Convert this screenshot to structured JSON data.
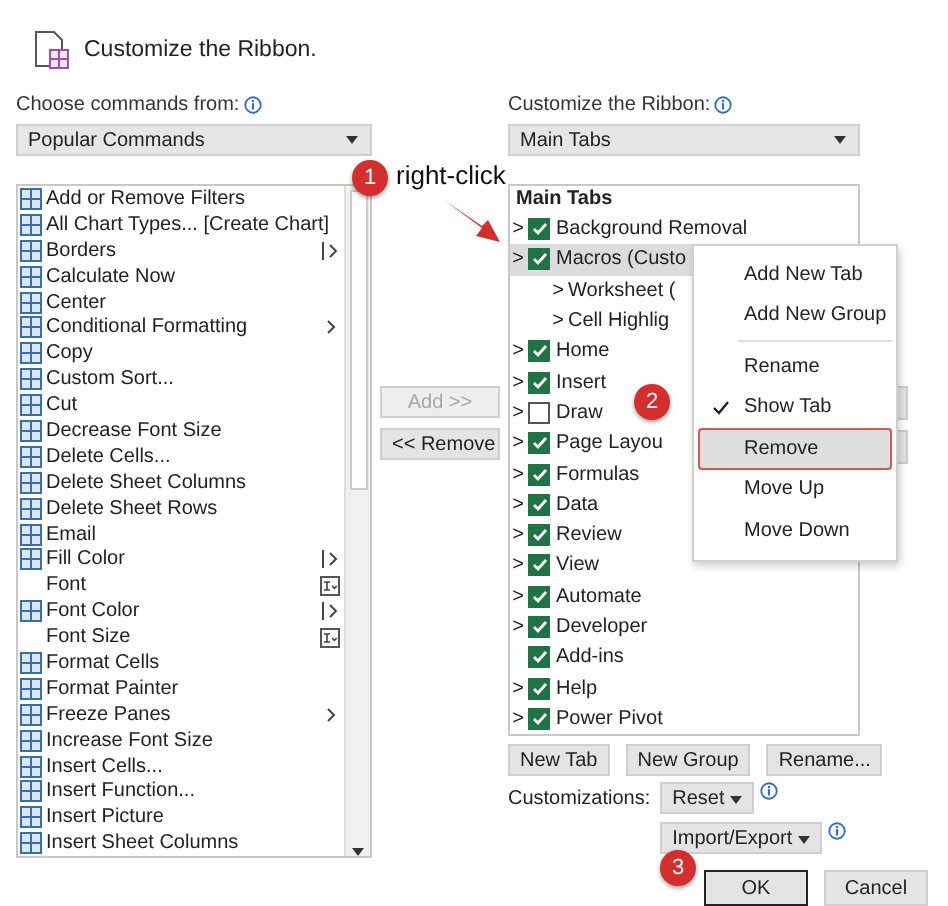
{
  "dialog": {
    "title": "Customize the Ribbon."
  },
  "commands": {
    "label": "Choose commands from:",
    "dropdown": "Popular Commands",
    "items": [
      {
        "label": "Add or Remove Filters",
        "kind": "command"
      },
      {
        "label": "All Chart Types... [Create Chart]",
        "kind": "command"
      },
      {
        "label": "Borders",
        "kind": "command",
        "split": true
      },
      {
        "label": "Calculate Now",
        "kind": "command"
      },
      {
        "label": "Center",
        "kind": "command"
      },
      {
        "label": "Conditional Formatting",
        "kind": "command",
        "submenu": true
      },
      {
        "label": "Copy",
        "kind": "command"
      },
      {
        "label": "Custom Sort...",
        "kind": "command"
      },
      {
        "label": "Cut",
        "kind": "command"
      },
      {
        "label": "Decrease Font Size",
        "kind": "command"
      },
      {
        "label": "Delete Cells...",
        "kind": "command"
      },
      {
        "label": "Delete Sheet Columns",
        "kind": "command"
      },
      {
        "label": "Delete Sheet Rows",
        "kind": "command"
      },
      {
        "label": "Email",
        "kind": "command"
      },
      {
        "label": "Fill Color",
        "kind": "command",
        "split": true
      },
      {
        "label": "Font",
        "kind": "plain",
        "combo": true
      },
      {
        "label": "Font Color",
        "kind": "command",
        "split": true
      },
      {
        "label": "Font Size",
        "kind": "plain",
        "combo": true
      },
      {
        "label": "Format Cells",
        "kind": "command"
      },
      {
        "label": "Format Painter",
        "kind": "command"
      },
      {
        "label": "Freeze Panes",
        "kind": "command",
        "submenu": true
      },
      {
        "label": "Increase Font Size",
        "kind": "command"
      },
      {
        "label": "Insert Cells...",
        "kind": "command"
      },
      {
        "label": "Insert Function...",
        "kind": "command"
      },
      {
        "label": "Insert Picture",
        "kind": "command"
      },
      {
        "label": "Insert Sheet Columns",
        "kind": "command"
      }
    ]
  },
  "middle_buttons": [
    {
      "label": "Add >>",
      "disabled": true
    },
    {
      "label": "<< Remove",
      "disabled": false
    }
  ],
  "ribbon": {
    "label": "Customize the Ribbon:",
    "dropdown": "Main Tabs",
    "tree_heading": "Main Tabs",
    "tabs": [
      {
        "label": "Background Removal",
        "expander": ">",
        "checked": true,
        "selected": false
      },
      {
        "label": "Macros (Custo",
        "expander": ">",
        "checked": true,
        "selected": true,
        "children": [
          {
            "label": "Worksheet (",
            "expander": ">"
          },
          {
            "label": "Cell Highlig",
            "expander": ">"
          }
        ]
      },
      {
        "label": "Home",
        "expander": ">",
        "checked": true,
        "selected": false
      },
      {
        "label": "Insert",
        "expander": ">",
        "checked": true,
        "selected": false
      },
      {
        "label": "Draw",
        "expander": ">",
        "checked": false,
        "selected": false
      },
      {
        "label": "Page Layou",
        "expander": ">",
        "checked": true,
        "selected": false
      },
      {
        "label": "Formulas",
        "expander": ">",
        "checked": true,
        "selected": false
      },
      {
        "label": "Data",
        "expander": ">",
        "checked": true,
        "selected": false
      },
      {
        "label": "Review",
        "expander": ">",
        "checked": true,
        "selected": false
      },
      {
        "label": "View",
        "expander": ">",
        "checked": true,
        "selected": false
      },
      {
        "label": "Automate",
        "expander": ">",
        "checked": true,
        "selected": false
      },
      {
        "label": "Developer",
        "expander": ">",
        "checked": true,
        "selected": false
      },
      {
        "label": "Add-ins",
        "checked": true,
        "selected": false
      },
      {
        "label": "Help",
        "expander": ">",
        "checked": true,
        "selected": false
      },
      {
        "label": "Power Pivot",
        "expander": ">",
        "checked": true,
        "selected": false
      }
    ],
    "buttons": [
      "New Tab",
      "New Group",
      "Rename..."
    ],
    "customizations_label": "Customizations:",
    "reset": "Reset",
    "import_export": "Import/Export"
  },
  "context_menu": [
    {
      "kind": "item",
      "label": "Add New Tab",
      "checked": false,
      "selected": false
    },
    {
      "kind": "item",
      "label": "Add New Group",
      "checked": false,
      "selected": false
    },
    {
      "kind": "separator"
    },
    {
      "kind": "item",
      "label": "Rename",
      "checked": false,
      "selected": false
    },
    {
      "kind": "item",
      "label": "Show Tab",
      "checked": true,
      "selected": false
    },
    {
      "kind": "item",
      "label": "Remove",
      "checked": false,
      "selected": true
    },
    {
      "kind": "item",
      "label": "Move Up",
      "checked": false,
      "selected": false
    },
    {
      "kind": "item",
      "label": "Move Down",
      "checked": false,
      "selected": false
    }
  ],
  "footer_buttons": [
    {
      "label": "OK",
      "default": true
    },
    {
      "label": "Cancel",
      "default": false
    }
  ],
  "annotations": {
    "steps": [
      "1",
      "2",
      "3"
    ],
    "note": "right-click"
  }
}
